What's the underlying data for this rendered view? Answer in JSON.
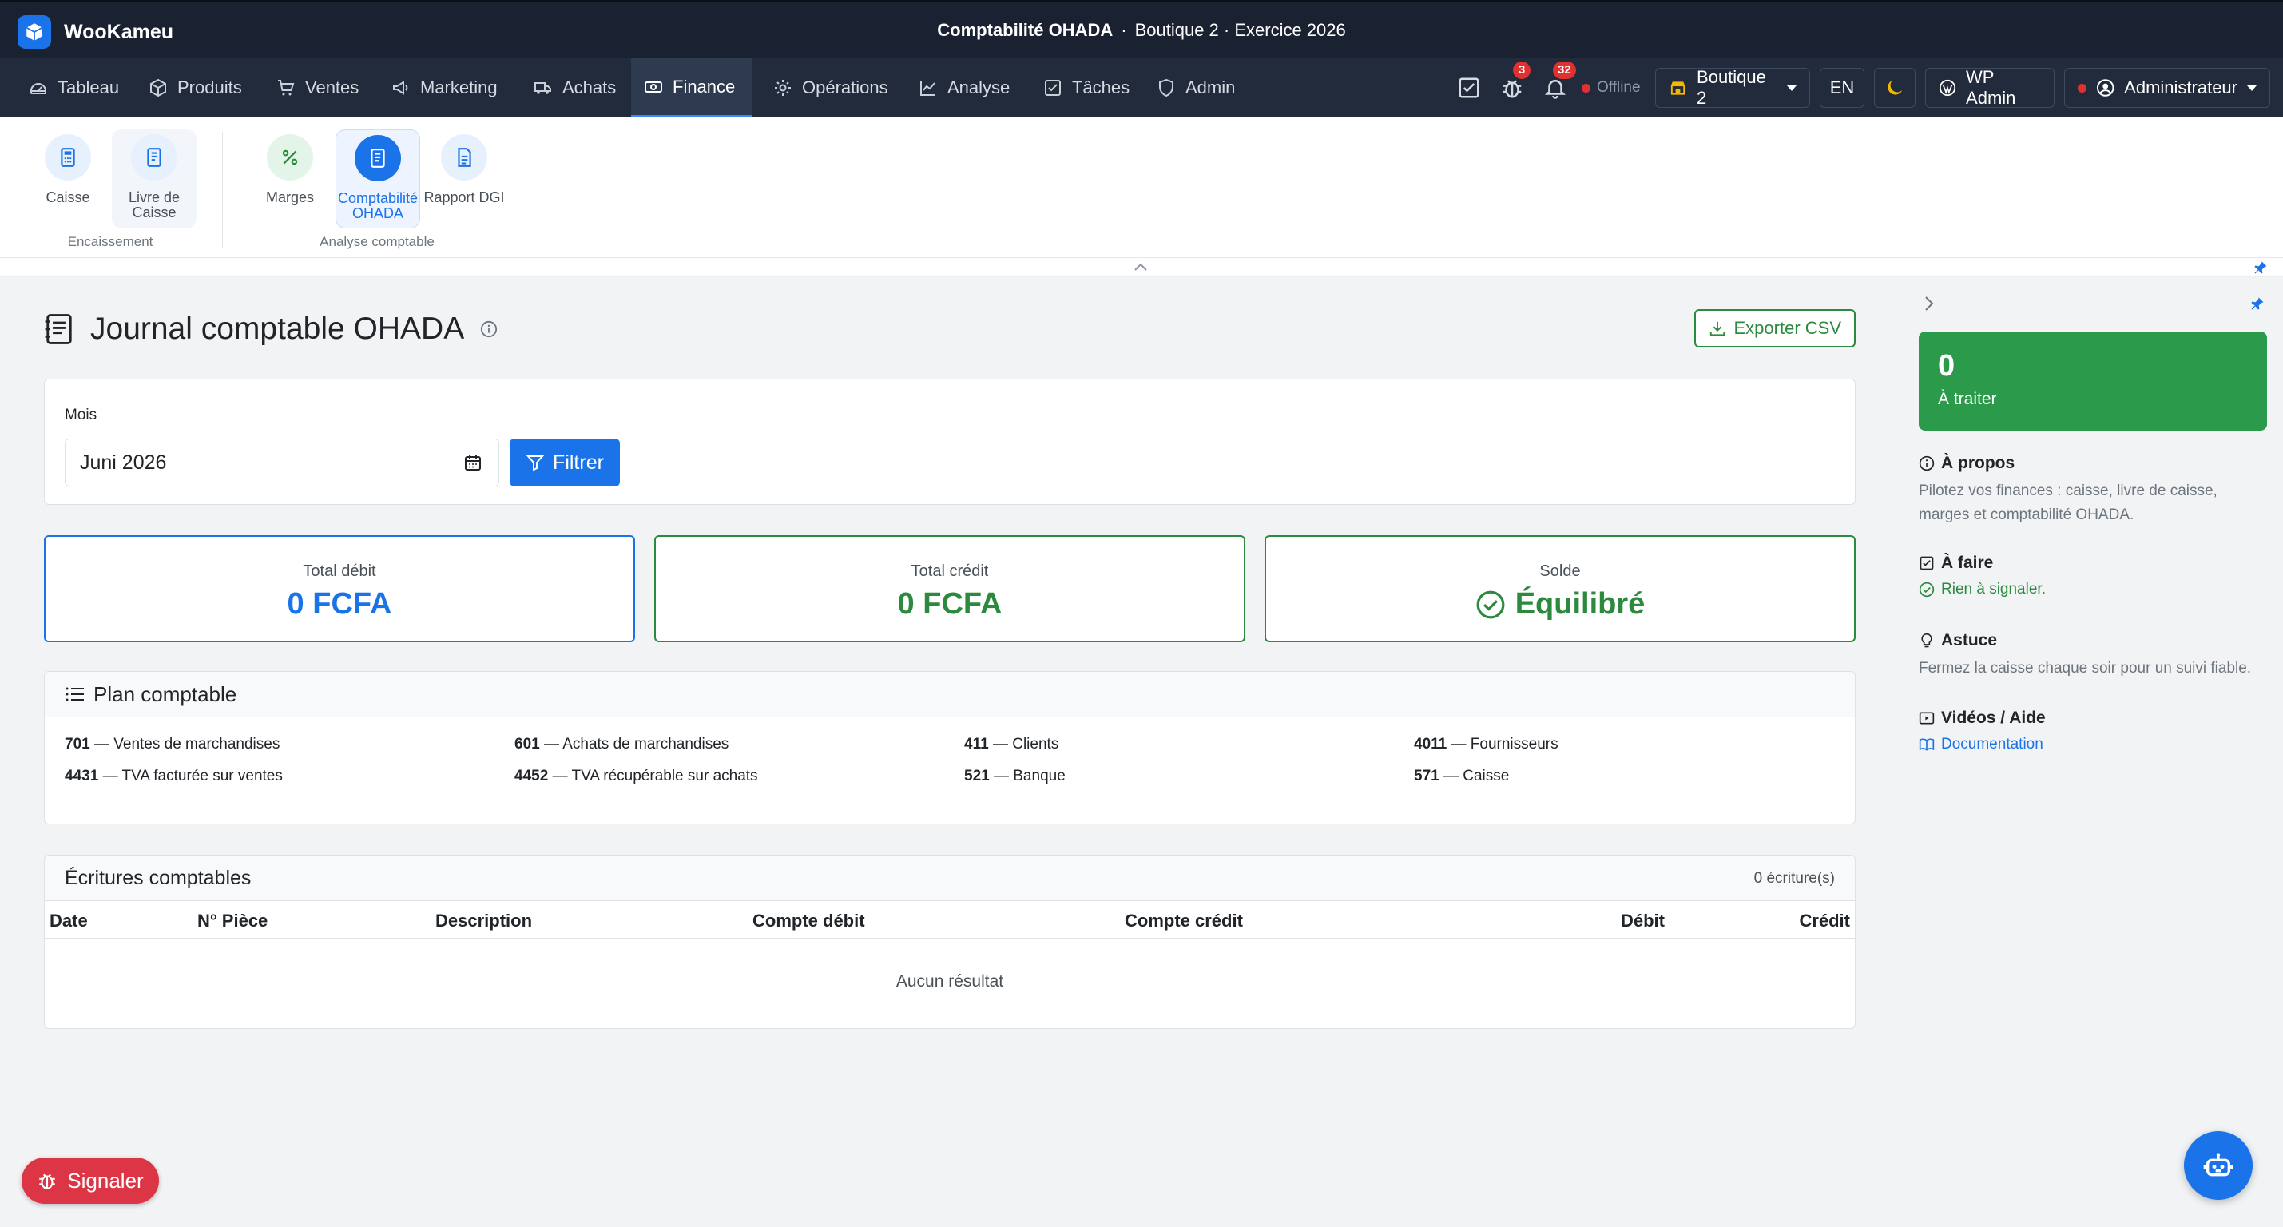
{
  "app": {
    "brand": "WooKameu",
    "title_main": "Comptabilité OHADA",
    "title_sep": "·",
    "title_context": "Boutique 2 · Exercice 2026"
  },
  "nav": {
    "items": [
      {
        "label": "Tableau",
        "icon": "dashboard-icon"
      },
      {
        "label": "Produits",
        "icon": "box-icon"
      },
      {
        "label": "Ventes",
        "icon": "cart-icon"
      },
      {
        "label": "Marketing",
        "icon": "megaphone-icon"
      },
      {
        "label": "Achats",
        "icon": "truck-icon"
      },
      {
        "label": "Finance",
        "icon": "cash-icon",
        "active": true
      },
      {
        "label": "Opérations",
        "icon": "gear-icon"
      },
      {
        "label": "Analyse",
        "icon": "chart-icon"
      },
      {
        "label": "Tâches",
        "icon": "checkbox-icon"
      },
      {
        "label": "Admin",
        "icon": "shield-icon"
      }
    ],
    "bug_badge": "3",
    "notif_badge": "32",
    "offline": "Offline",
    "shop": "Boutique 2",
    "lang": "EN",
    "wp_admin": "WP Admin",
    "user": "Administrateur"
  },
  "subnav": {
    "items": [
      {
        "label": "Caisse"
      },
      {
        "label": "Livre de Caisse"
      },
      {
        "label": "Marges"
      },
      {
        "label": "Comptabilité OHADA"
      },
      {
        "label": "Rapport DGI"
      }
    ],
    "groups": [
      "Encaissement",
      "Analyse comptable"
    ]
  },
  "page": {
    "title": "Journal comptable OHADA",
    "export_label": "Exporter CSV",
    "filter": {
      "label": "Mois",
      "month_value": "Juni 2026",
      "button": "Filtrer"
    },
    "stats": {
      "debit_label": "Total débit",
      "debit_value": "0 FCFA",
      "credit_label": "Total crédit",
      "credit_value": "0 FCFA",
      "solde_label": "Solde",
      "solde_value": "Équilibré"
    },
    "plan": {
      "title": "Plan comptable",
      "entries": [
        {
          "code": "701",
          "label": "— Ventes de marchandises"
        },
        {
          "code": "601",
          "label": "— Achats de marchandises"
        },
        {
          "code": "411",
          "label": "— Clients"
        },
        {
          "code": "4011",
          "label": "— Fournisseurs"
        },
        {
          "code": "4431",
          "label": "— TVA facturée sur ventes"
        },
        {
          "code": "4452",
          "label": "— TVA récupérable sur achats"
        },
        {
          "code": "521",
          "label": "— Banque"
        },
        {
          "code": "571",
          "label": "— Caisse"
        }
      ]
    },
    "ecritures": {
      "title": "Écritures comptables",
      "count": "0 écriture(s)",
      "columns": [
        "Date",
        "N° Pièce",
        "Description",
        "Compte débit",
        "Compte crédit",
        "Débit",
        "Crédit"
      ],
      "empty": "Aucun résultat"
    }
  },
  "panel": {
    "todo_count": "0",
    "todo_label": "À traiter",
    "about_title": "À propos",
    "about_text": "Pilotez vos finances : caisse, livre de caisse, marges et comptabilité OHADA.",
    "afaire_title": "À faire",
    "afaire_text": "Rien à signaler.",
    "astuce_title": "Astuce",
    "astuce_text": "Fermez la caisse chaque soir pour un suivi fiable.",
    "videos_title": "Vidéos / Aide",
    "doc_link": "Documentation"
  },
  "signaler": "Signaler",
  "colors": {
    "primary": "#1a73e8",
    "success": "#2b8a3e",
    "danger": "#dc3545",
    "topbar": "#1a2232"
  }
}
